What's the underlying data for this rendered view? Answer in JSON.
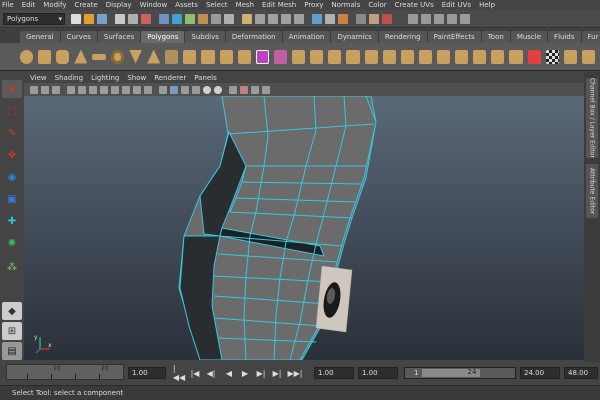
{
  "menu": [
    "File",
    "Edit",
    "Modify",
    "Create",
    "Display",
    "Window",
    "Assets",
    "Select",
    "Mesh",
    "Edit Mesh",
    "Proxy",
    "Normals",
    "Color",
    "Create UVs",
    "Edit UVs",
    "Help"
  ],
  "status": {
    "mode": "Polygons"
  },
  "shelf_tabs": [
    "General",
    "Curves",
    "Surfaces",
    "Polygons",
    "Subdivs",
    "Deformation",
    "Animation",
    "Dynamics",
    "Rendering",
    "PaintEffects",
    "Toon",
    "Muscle",
    "Fluids",
    "Fur"
  ],
  "shelf_active": "Polygons",
  "panel_menu": [
    "View",
    "Shading",
    "Lighting",
    "Show",
    "Renderer",
    "Panels"
  ],
  "side_tabs": {
    "channel_box": "Channel Box / Layer Editor",
    "attribute_editor": "Attribute Editor"
  },
  "axis": {
    "y": "y",
    "x": "x"
  },
  "timeline": {
    "ticks": [
      "10",
      "20"
    ],
    "current": "1.00"
  },
  "range": {
    "start": "1.00",
    "start2": "1.00",
    "slider_start": "1",
    "slider_end": "24",
    "end": "24.00",
    "end2": "48.00"
  },
  "playback": [
    "|◀◀",
    "|◀",
    "◀|",
    "◀",
    "▶",
    "▶|",
    "▶|",
    "▶▶|"
  ],
  "help_text": "Select Tool: select a component",
  "colors": {
    "wire": "#39c6e0",
    "mesh": "#6b6b6b",
    "bg": "#444444"
  }
}
